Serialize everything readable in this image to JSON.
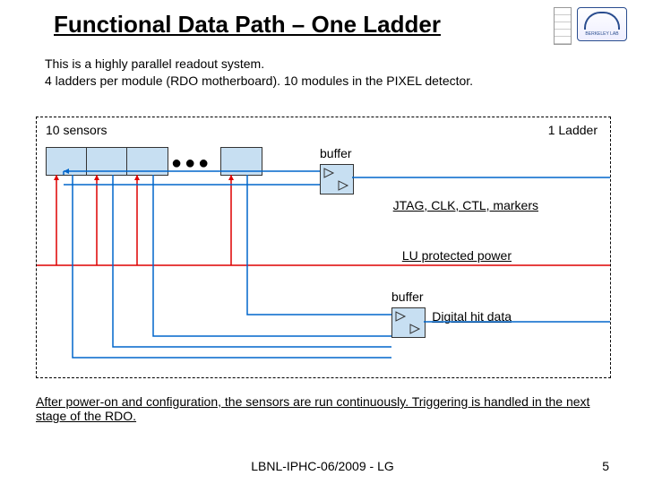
{
  "title": "Functional Data Path – One Ladder",
  "intro": {
    "line1": "This is a highly parallel readout system.",
    "line2": "4 ladders per module (RDO motherboard). 10 modules in the PIXEL detector."
  },
  "diagram": {
    "sensors_label": "10 sensors",
    "ladder_label": "1 Ladder",
    "dots": "●●●",
    "buffer_top_label": "buffer",
    "buffer_bot_label": "buffer",
    "signals_label": "JTAG, CLK, CTL, markers",
    "power_label": "LU protected power",
    "data_label": "Digital hit data"
  },
  "outro": "After power-on and configuration, the sensors are run continuously. Triggering is handled in the next stage of the RDO.",
  "footer": "LBNL-IPHC-06/2009 - LG",
  "page_number": "5",
  "logo_text": "BERKELEY LAB"
}
